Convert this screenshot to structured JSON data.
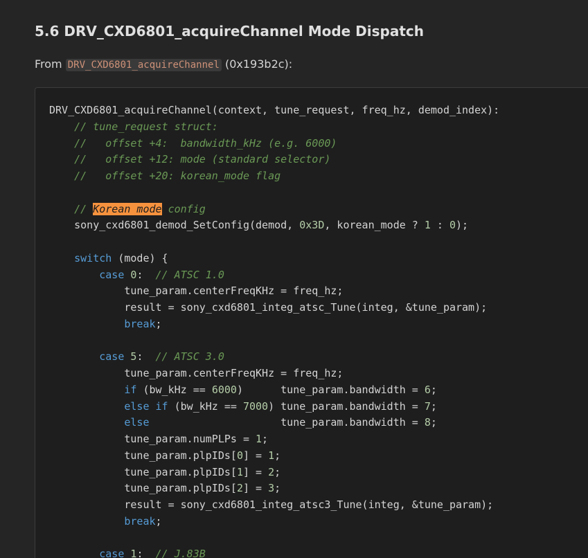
{
  "section": {
    "heading": "5.6 DRV_CXD6801_acquireChannel Mode Dispatch",
    "from_label": "From",
    "function_name": "DRV_CXD6801_acquireChannel",
    "address": "(0x193b2c):"
  },
  "code": {
    "lines": [
      [
        {
          "t": "DRV_CXD6801_acquireChannel(context, tune_request, freq_hz, demod_index):",
          "c": "plain"
        }
      ],
      [
        {
          "t": "    ",
          "c": "plain"
        },
        {
          "t": "// tune_request struct:",
          "c": "cmt"
        }
      ],
      [
        {
          "t": "    ",
          "c": "plain"
        },
        {
          "t": "//   offset +4:  bandwidth_kHz (e.g. 6000)",
          "c": "cmt"
        }
      ],
      [
        {
          "t": "    ",
          "c": "plain"
        },
        {
          "t": "//   offset +12: mode (standard selector)",
          "c": "cmt"
        }
      ],
      [
        {
          "t": "    ",
          "c": "plain"
        },
        {
          "t": "//   offset +20: korean_mode flag",
          "c": "cmt"
        }
      ],
      [],
      [
        {
          "t": "    ",
          "c": "plain"
        },
        {
          "t": "// ",
          "c": "cmt"
        },
        {
          "t": "Korean mode",
          "c": "hl"
        },
        {
          "t": " config",
          "c": "cmt"
        }
      ],
      [
        {
          "t": "    sony_cxd6801_demod_SetConfig(demod, ",
          "c": "plain"
        },
        {
          "t": "0x3D",
          "c": "num"
        },
        {
          "t": ", korean_mode ? ",
          "c": "plain"
        },
        {
          "t": "1",
          "c": "num"
        },
        {
          "t": " : ",
          "c": "plain"
        },
        {
          "t": "0",
          "c": "num"
        },
        {
          "t": ");",
          "c": "plain"
        }
      ],
      [],
      [
        {
          "t": "    ",
          "c": "plain"
        },
        {
          "t": "switch",
          "c": "kw"
        },
        {
          "t": " (mode) {",
          "c": "plain"
        }
      ],
      [
        {
          "t": "        ",
          "c": "plain"
        },
        {
          "t": "case",
          "c": "kw"
        },
        {
          "t": " ",
          "c": "plain"
        },
        {
          "t": "0",
          "c": "num"
        },
        {
          "t": ":  ",
          "c": "plain"
        },
        {
          "t": "// ATSC 1.0",
          "c": "cmt"
        }
      ],
      [
        {
          "t": "            tune_param.centerFreqKHz = freq_hz;",
          "c": "plain"
        }
      ],
      [
        {
          "t": "            result = sony_cxd6801_integ_atsc_Tune(integ, &tune_param);",
          "c": "plain"
        }
      ],
      [
        {
          "t": "            ",
          "c": "plain"
        },
        {
          "t": "break",
          "c": "kw"
        },
        {
          "t": ";",
          "c": "plain"
        }
      ],
      [],
      [
        {
          "t": "        ",
          "c": "plain"
        },
        {
          "t": "case",
          "c": "kw"
        },
        {
          "t": " ",
          "c": "plain"
        },
        {
          "t": "5",
          "c": "num"
        },
        {
          "t": ":  ",
          "c": "plain"
        },
        {
          "t": "// ATSC 3.0",
          "c": "cmt"
        }
      ],
      [
        {
          "t": "            tune_param.centerFreqKHz = freq_hz;",
          "c": "plain"
        }
      ],
      [
        {
          "t": "            ",
          "c": "plain"
        },
        {
          "t": "if",
          "c": "kw"
        },
        {
          "t": " (bw_kHz == ",
          "c": "plain"
        },
        {
          "t": "6000",
          "c": "num"
        },
        {
          "t": ")      tune_param.bandwidth = ",
          "c": "plain"
        },
        {
          "t": "6",
          "c": "num"
        },
        {
          "t": ";",
          "c": "plain"
        }
      ],
      [
        {
          "t": "            ",
          "c": "plain"
        },
        {
          "t": "else if",
          "c": "kw"
        },
        {
          "t": " (bw_kHz == ",
          "c": "plain"
        },
        {
          "t": "7000",
          "c": "num"
        },
        {
          "t": ") tune_param.bandwidth = ",
          "c": "plain"
        },
        {
          "t": "7",
          "c": "num"
        },
        {
          "t": ";",
          "c": "plain"
        }
      ],
      [
        {
          "t": "            ",
          "c": "plain"
        },
        {
          "t": "else",
          "c": "kw"
        },
        {
          "t": "                     tune_param.bandwidth = ",
          "c": "plain"
        },
        {
          "t": "8",
          "c": "num"
        },
        {
          "t": ";",
          "c": "plain"
        }
      ],
      [
        {
          "t": "            tune_param.numPLPs = ",
          "c": "plain"
        },
        {
          "t": "1",
          "c": "num"
        },
        {
          "t": ";",
          "c": "plain"
        }
      ],
      [
        {
          "t": "            tune_param.plpIDs[",
          "c": "plain"
        },
        {
          "t": "0",
          "c": "num"
        },
        {
          "t": "] = ",
          "c": "plain"
        },
        {
          "t": "1",
          "c": "num"
        },
        {
          "t": ";",
          "c": "plain"
        }
      ],
      [
        {
          "t": "            tune_param.plpIDs[",
          "c": "plain"
        },
        {
          "t": "1",
          "c": "num"
        },
        {
          "t": "] = ",
          "c": "plain"
        },
        {
          "t": "2",
          "c": "num"
        },
        {
          "t": ";",
          "c": "plain"
        }
      ],
      [
        {
          "t": "            tune_param.plpIDs[",
          "c": "plain"
        },
        {
          "t": "2",
          "c": "num"
        },
        {
          "t": "] = ",
          "c": "plain"
        },
        {
          "t": "3",
          "c": "num"
        },
        {
          "t": ";",
          "c": "plain"
        }
      ],
      [
        {
          "t": "            result = sony_cxd6801_integ_atsc3_Tune(integ, &tune_param);",
          "c": "plain"
        }
      ],
      [
        {
          "t": "            ",
          "c": "plain"
        },
        {
          "t": "break",
          "c": "kw"
        },
        {
          "t": ";",
          "c": "plain"
        }
      ],
      [],
      [
        {
          "t": "        ",
          "c": "plain"
        },
        {
          "t": "case",
          "c": "kw"
        },
        {
          "t": " ",
          "c": "plain"
        },
        {
          "t": "1",
          "c": "num"
        },
        {
          "t": ":  ",
          "c": "plain"
        },
        {
          "t": "// J.83B",
          "c": "cmt"
        }
      ]
    ]
  }
}
